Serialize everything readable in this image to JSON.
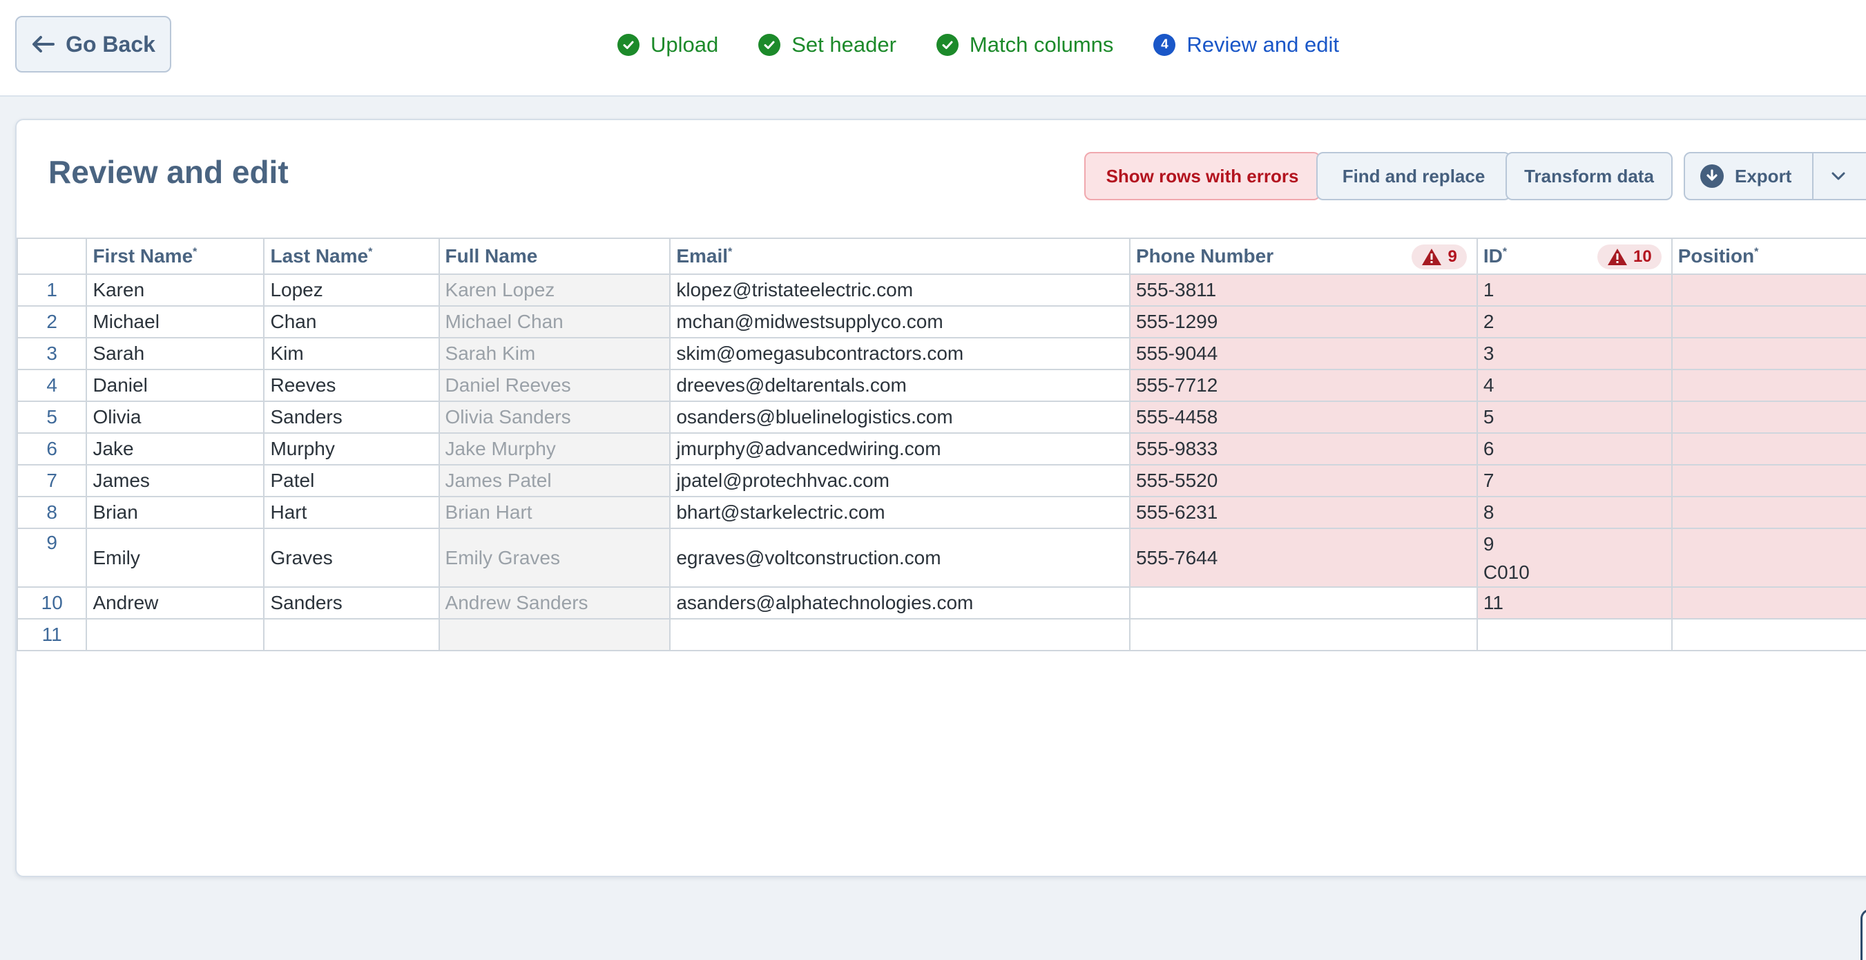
{
  "header": {
    "back_label": "Go Back",
    "steps": [
      {
        "label": "Upload",
        "state": "done"
      },
      {
        "label": "Set header",
        "state": "done"
      },
      {
        "label": "Match columns",
        "state": "done"
      },
      {
        "label": "Review and edit",
        "state": "current",
        "number": "4"
      }
    ]
  },
  "main": {
    "title": "Review and edit",
    "buttons": {
      "show_errors": "Show rows with errors",
      "find_replace": "Find and replace",
      "transform": "Transform data",
      "export": "Export"
    }
  },
  "table": {
    "columns": [
      {
        "label": "First Name",
        "required": true
      },
      {
        "label": "Last Name",
        "required": true
      },
      {
        "label": "Full Name",
        "required": false
      },
      {
        "label": "Email",
        "required": true
      },
      {
        "label": "Phone Number",
        "required": false,
        "error_count": "9"
      },
      {
        "label": "ID",
        "required": true,
        "error_count": "10"
      },
      {
        "label": "Position",
        "required": true
      }
    ],
    "rows": [
      {
        "num": "1",
        "first": "Karen",
        "last": "Lopez",
        "full": "Karen Lopez",
        "email": "klopez@tristateelectric.com",
        "phone": "555-3811",
        "id": "1",
        "id2": "",
        "position": ""
      },
      {
        "num": "2",
        "first": "Michael",
        "last": "Chan",
        "full": "Michael Chan",
        "email": "mchan@midwestsupplyco.com",
        "phone": "555-1299",
        "id": "2",
        "id2": "",
        "position": ""
      },
      {
        "num": "3",
        "first": "Sarah",
        "last": "Kim",
        "full": "Sarah Kim",
        "email": "skim@omegasubcontractors.com",
        "phone": "555-9044",
        "id": "3",
        "id2": "",
        "position": ""
      },
      {
        "num": "4",
        "first": "Daniel",
        "last": "Reeves",
        "full": "Daniel Reeves",
        "email": "dreeves@deltarentals.com",
        "phone": "555-7712",
        "id": "4",
        "id2": "",
        "position": ""
      },
      {
        "num": "5",
        "first": "Olivia",
        "last": "Sanders",
        "full": "Olivia Sanders",
        "email": "osanders@bluelinelogistics.com",
        "phone": "555-4458",
        "id": "5",
        "id2": "",
        "position": ""
      },
      {
        "num": "6",
        "first": "Jake",
        "last": "Murphy",
        "full": "Jake Murphy",
        "email": "jmurphy@advancedwiring.com",
        "phone": "555-9833",
        "id": "6",
        "id2": "",
        "position": ""
      },
      {
        "num": "7",
        "first": "James",
        "last": "Patel",
        "full": "James Patel",
        "email": "jpatel@protechhvac.com",
        "phone": "555-5520",
        "id": "7",
        "id2": "",
        "position": ""
      },
      {
        "num": "8",
        "first": "Brian",
        "last": "Hart",
        "full": "Brian Hart",
        "email": "bhart@starkelectric.com",
        "phone": "555-6231",
        "id": "8",
        "id2": "",
        "position": ""
      },
      {
        "num": "9",
        "first": "Emily",
        "last": "Graves",
        "full": "Emily Graves",
        "email": "egraves@voltconstruction.com",
        "phone": "555-7644",
        "id": "9",
        "id2": "C010",
        "position": ""
      },
      {
        "num": "10",
        "first": "Andrew",
        "last": "Sanders",
        "full": "Andrew Sanders",
        "email": "asanders@alphatechnologies.com",
        "phone": "",
        "id": "11",
        "id2": "",
        "position": ""
      },
      {
        "num": "11",
        "first": "",
        "last": "",
        "full": "",
        "email": "",
        "phone": "",
        "id": "",
        "id2": "",
        "position": ""
      }
    ]
  },
  "colors": {
    "done": "#1c8a2a",
    "current": "#1a57c8",
    "error_bg": "#f7dfe1",
    "error_text": "#b3141f",
    "heading": "#4a6481"
  },
  "icons": {
    "back": "arrow-left-icon",
    "done_step": "check-circle-icon",
    "warning": "warning-triangle-icon",
    "export": "download-circle-icon",
    "dropdown": "chevron-down-icon"
  }
}
